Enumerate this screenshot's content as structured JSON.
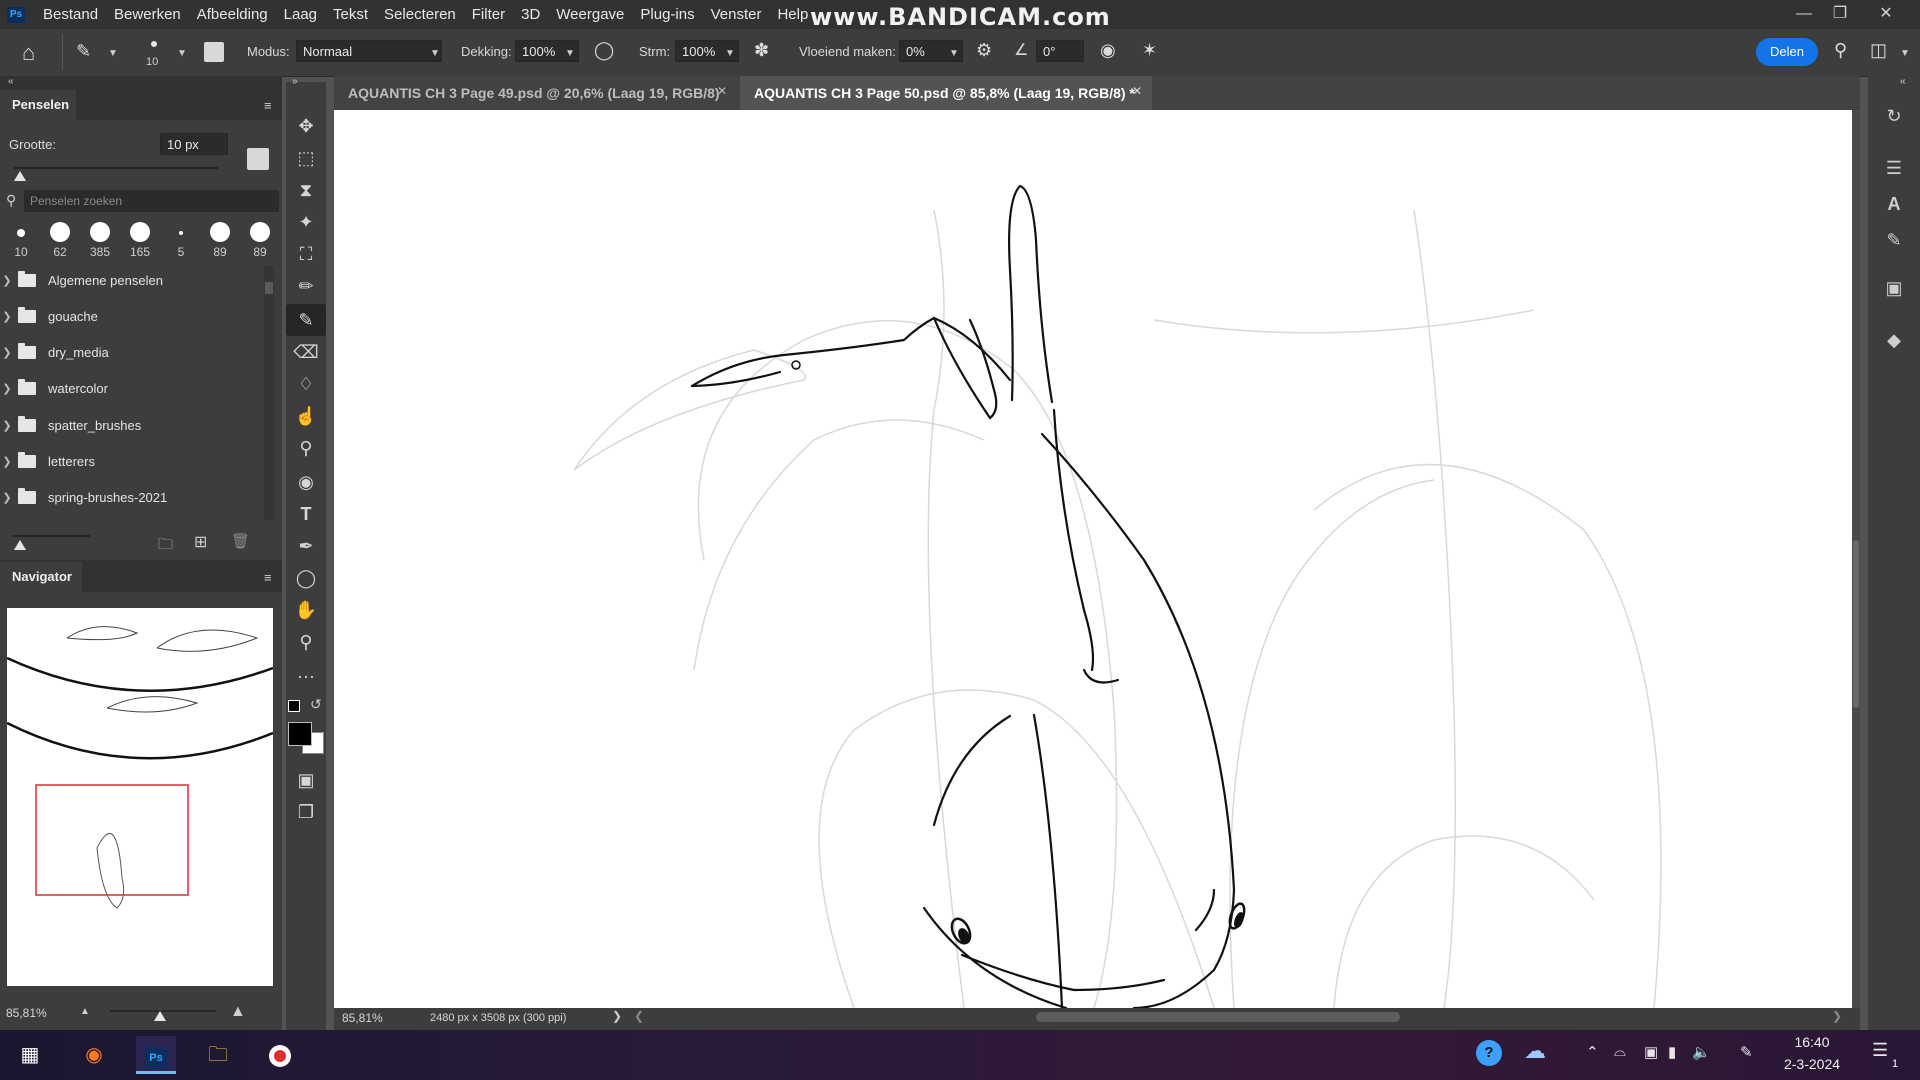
{
  "menubar": {
    "app_icon": "Ps",
    "items": [
      "Bestand",
      "Bewerken",
      "Afbeelding",
      "Laag",
      "Tekst",
      "Selecteren",
      "Filter",
      "3D",
      "Weergave",
      "Plug-ins",
      "Venster",
      "Help"
    ],
    "watermark": "www.BANDICAM.com"
  },
  "options": {
    "brush_size": "10",
    "mode_label": "Modus:",
    "mode_value": "Normaal",
    "opacity_label": "Dekking:",
    "opacity_value": "100%",
    "flow_label": "Strm:",
    "flow_value": "100%",
    "smoothing_label": "Vloeiend maken:",
    "smoothing_value": "0%",
    "angle_value": "0°",
    "share_label": "Delen"
  },
  "brushes_panel": {
    "tab": "Penselen",
    "size_label": "Grootte:",
    "size_value": "10 px",
    "search_placeholder": "Penselen zoeken",
    "presets": [
      "10",
      "62",
      "385",
      "165",
      "5",
      "89",
      "89"
    ],
    "folders": [
      "Algemene penselen",
      "gouache",
      "dry_media",
      "watercolor",
      "spatter_brushes",
      "letterers",
      "spring-brushes-2021"
    ]
  },
  "navigator": {
    "tab": "Navigator",
    "zoom": "85,81%"
  },
  "tabs": [
    {
      "label": "AQUANTIS CH 3 Page 49.psd @ 20,6% (Laag 19, RGB/8)"
    },
    {
      "label": "AQUANTIS CH 3 Page 50.psd @ 85,8% (Laag 19, RGB/8) *"
    }
  ],
  "status": {
    "zoom": "85,81%",
    "doc_info": "2480 px x 3508 px (300 ppi)"
  },
  "taskbar": {
    "time": "16:40",
    "date": "2-3-2024",
    "notification_count": "1"
  },
  "colors": {
    "accent": "#1473e6",
    "nav_frame": "#d9302c",
    "foreground": "#000000",
    "background": "#ffffff"
  }
}
